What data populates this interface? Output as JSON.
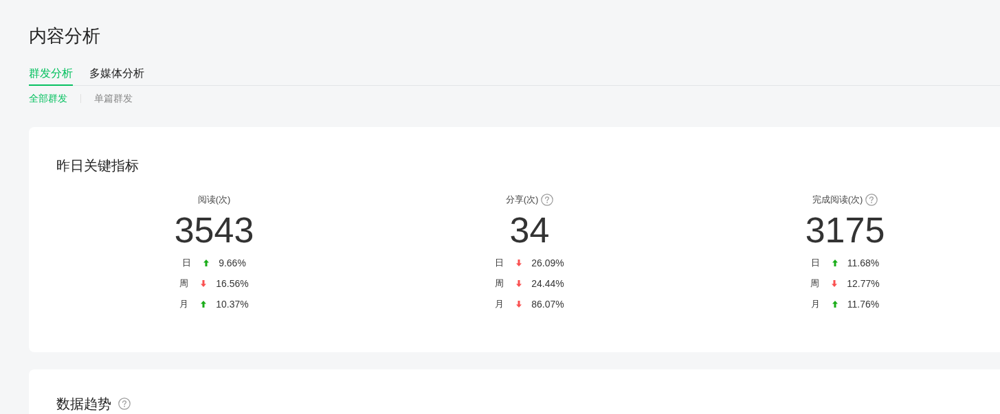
{
  "page": {
    "title": "内容分析"
  },
  "tabs": [
    {
      "label": "群发分析",
      "selected": true
    },
    {
      "label": "多媒体分析",
      "selected": false
    }
  ],
  "subtabs": [
    {
      "label": "全部群发",
      "selected": true
    },
    {
      "label": "单篇群发",
      "selected": false
    }
  ],
  "key_metrics": {
    "title": "昨日关键指标",
    "metrics": [
      {
        "label": "阅读(次)",
        "help": false,
        "value": "3543",
        "changes": [
          {
            "period": "日",
            "kind": "up",
            "percent": "9.66%"
          },
          {
            "period": "周",
            "kind": "down",
            "percent": "16.56%"
          },
          {
            "period": "月",
            "kind": "up",
            "percent": "10.37%"
          }
        ]
      },
      {
        "label": "分享(次)",
        "help": true,
        "value": "34",
        "changes": [
          {
            "period": "日",
            "kind": "down",
            "percent": "26.09%"
          },
          {
            "period": "周",
            "kind": "down",
            "percent": "24.44%"
          },
          {
            "period": "月",
            "kind": "down",
            "percent": "86.07%"
          }
        ]
      },
      {
        "label": "完成阅读(次)",
        "help": true,
        "value": "3175",
        "changes": [
          {
            "period": "日",
            "kind": "up",
            "percent": "11.68%"
          },
          {
            "period": "周",
            "kind": "down",
            "percent": "12.77%"
          },
          {
            "period": "月",
            "kind": "up",
            "percent": "11.76%"
          }
        ]
      }
    ]
  },
  "trend_section": {
    "title": "数据趋势",
    "help": true
  }
}
